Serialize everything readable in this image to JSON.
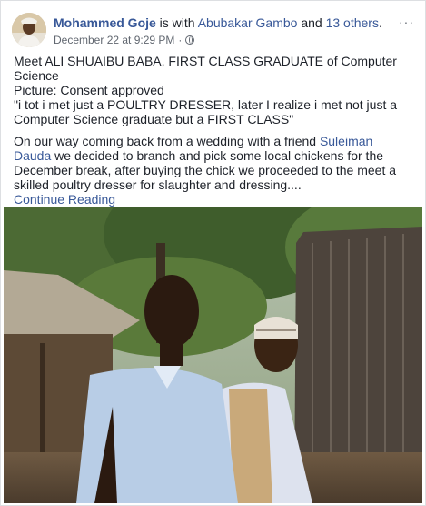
{
  "post": {
    "author": "Mohammed Goje",
    "with_text": " is with ",
    "tagged_name": "Abubakar Gambo",
    "and_text": " and ",
    "others_link": "13 others",
    "period": ".",
    "timestamp": "December 22 at 9:29 PM",
    "meta_sep": "·",
    "privacy_icon": "globe-icon",
    "more_label": "···",
    "lines": {
      "p1": "Meet ALI SHUAIBU BABA, FIRST CLASS GRADUATE of Computer Science",
      "p2": "Picture: Consent approved",
      "p3": "\"i tot i met just a POULTRY DRESSER, later I realize i met not just a Computer Science graduate but a FIRST CLASS\"",
      "p4_before": "On our way coming back from a wedding with a friend ",
      "p4_link": "Suleiman Dauda",
      "p4_after": " we decided to branch and pick some local chickens for the December break, after buying the chick we proceeded to the meet a skilled poultry dresser for slaughter and dressing....",
      "continue": "Continue Reading"
    }
  },
  "colors": {
    "link": "#385898",
    "text": "#1d2129",
    "meta": "#616770",
    "page_bg": "#e9ebee"
  }
}
